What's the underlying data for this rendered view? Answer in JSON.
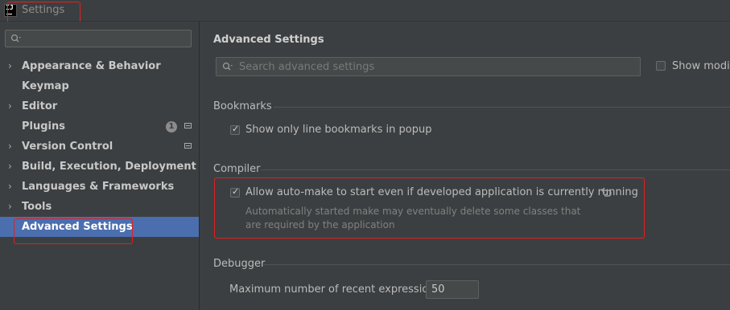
{
  "window": {
    "title": "Settings"
  },
  "sidebar": {
    "search_placeholder": "",
    "items": [
      {
        "label": "Appearance & Behavior",
        "has_children": true
      },
      {
        "label": "Keymap",
        "has_children": false
      },
      {
        "label": "Editor",
        "has_children": true
      },
      {
        "label": "Plugins",
        "has_children": false,
        "badge": "1"
      },
      {
        "label": "Version Control",
        "has_children": true
      },
      {
        "label": "Build, Execution, Deployment",
        "has_children": true
      },
      {
        "label": "Languages & Frameworks",
        "has_children": true
      },
      {
        "label": "Tools",
        "has_children": true
      },
      {
        "label": "Advanced Settings",
        "has_children": false,
        "selected": true
      }
    ]
  },
  "main": {
    "heading": "Advanced Settings",
    "search": {
      "placeholder": "Search advanced settings"
    },
    "show_modified_label": "Show modifi",
    "sections": {
      "bookmarks": {
        "title": "Bookmarks",
        "option": {
          "label": "Show only line bookmarks in popup",
          "checked": true
        }
      },
      "compiler": {
        "title": "Compiler",
        "option": {
          "label": "Allow auto-make to start even if developed application is currently running",
          "checked": true
        },
        "description_line1": "Automatically started make may eventually delete some classes that",
        "description_line2": "are required by the application"
      },
      "debugger": {
        "title": "Debugger",
        "field_label": "Maximum number of recent expressions:",
        "field_value": "50"
      }
    }
  },
  "colors": {
    "selection": "#4b6eaf",
    "highlight_box": "#e02020",
    "background": "#3c3f41"
  }
}
